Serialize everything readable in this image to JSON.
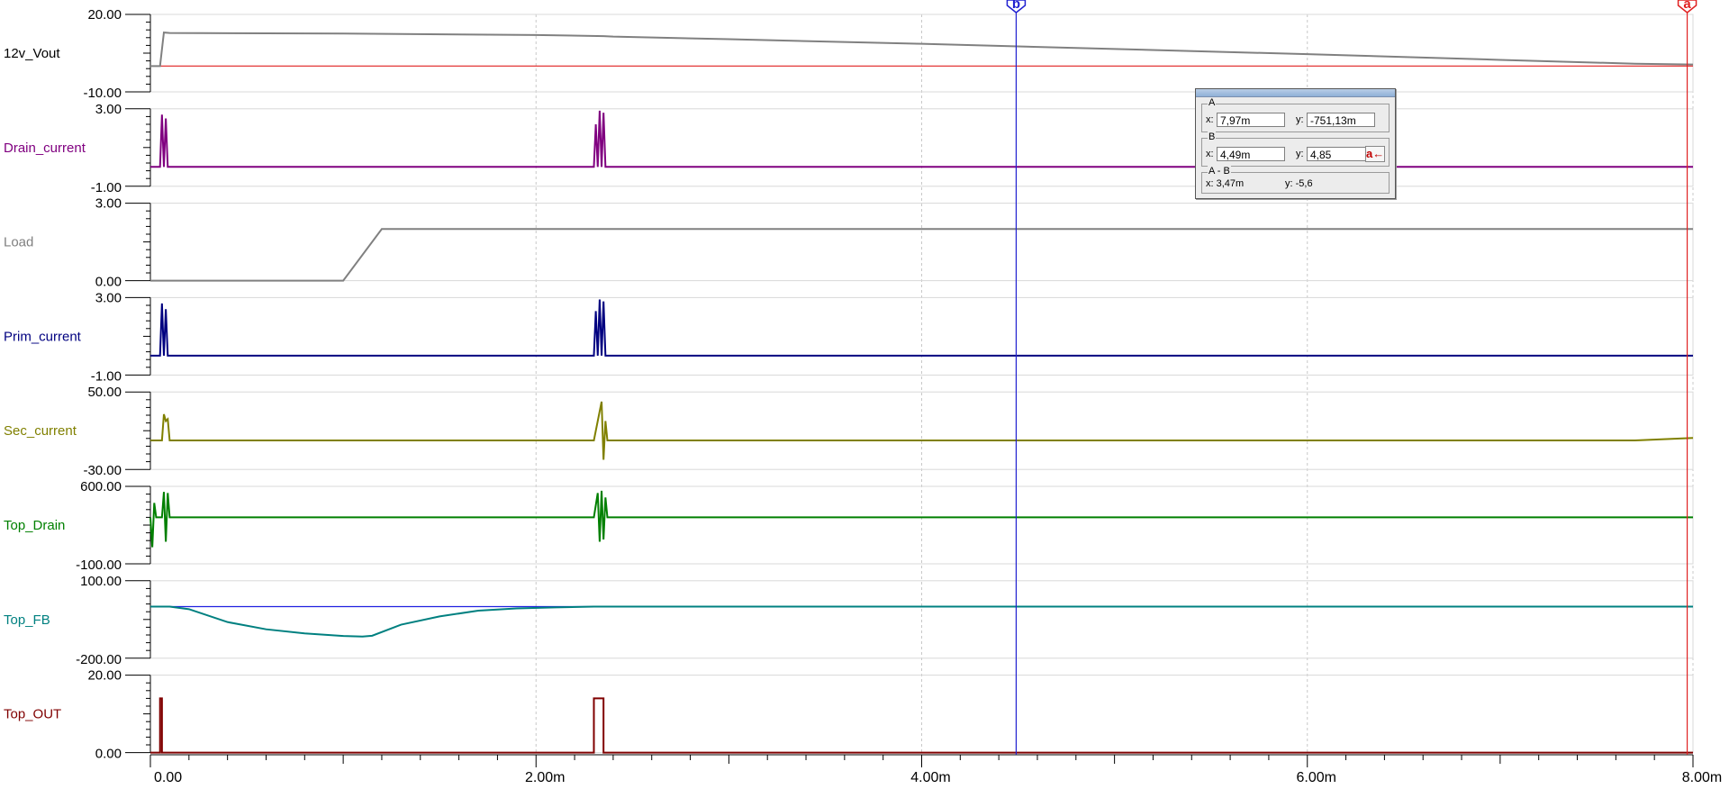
{
  "chart_data": {
    "type": "line",
    "x_axis": {
      "range": [
        0,
        0.008
      ],
      "tick_labels": [
        "0.00",
        "2.00m",
        "4.00m",
        "6.00m",
        "8.00m"
      ],
      "tick_values": [
        0,
        0.002,
        0.004,
        0.006,
        0.008
      ]
    },
    "grid": true,
    "panels": [
      {
        "name": "12v_Vout",
        "color": "#808080",
        "ymax_label": "20.00",
        "ymin_label": "-10.00",
        "ylim": [
          -10,
          20
        ],
        "points": [
          [
            0,
            0
          ],
          [
            5e-05,
            0
          ],
          [
            7e-05,
            13
          ],
          [
            0.0001,
            12.8
          ],
          [
            0.001,
            12.6
          ],
          [
            0.002,
            12
          ],
          [
            0.00235,
            11.6
          ],
          [
            0.0024,
            11.4
          ],
          [
            0.003,
            10.4
          ],
          [
            0.004,
            8.6
          ],
          [
            0.005,
            6.6
          ],
          [
            0.006,
            4.6
          ],
          [
            0.007,
            2.4
          ],
          [
            0.0077,
            0.9
          ],
          [
            0.008,
            0.6
          ]
        ],
        "ref_line": {
          "y": 0,
          "color": "#e02020"
        }
      },
      {
        "name": "Drain_current",
        "color": "#800080",
        "ymax_label": "3.00",
        "ymin_label": "-1.00",
        "ylim": [
          -1,
          3
        ],
        "points": [
          [
            0,
            0
          ],
          [
            5e-05,
            0
          ],
          [
            6e-05,
            2.7
          ],
          [
            7e-05,
            0
          ],
          [
            8e-05,
            2.5
          ],
          [
            9e-05,
            0
          ],
          [
            0.0023,
            0
          ],
          [
            0.00231,
            2.2
          ],
          [
            0.00232,
            0
          ],
          [
            0.00233,
            2.9
          ],
          [
            0.00234,
            0
          ],
          [
            0.00235,
            2.8
          ],
          [
            0.00236,
            0
          ],
          [
            0.008,
            0
          ]
        ]
      },
      {
        "name": "Load",
        "color": "#808080",
        "ymax_label": "3.00",
        "ymin_label": "0.00",
        "ylim": [
          0,
          3
        ],
        "points": [
          [
            0,
            0
          ],
          [
            0.001,
            0
          ],
          [
            0.0012,
            2
          ],
          [
            0.008,
            2
          ]
        ]
      },
      {
        "name": "Prim_current",
        "color": "#000080",
        "ymax_label": "3.00",
        "ymin_label": "-1.00",
        "ylim": [
          -1,
          3
        ],
        "points": [
          [
            0,
            0
          ],
          [
            5e-05,
            0
          ],
          [
            6e-05,
            2.7
          ],
          [
            7e-05,
            0
          ],
          [
            8e-05,
            2.4
          ],
          [
            9e-05,
            0
          ],
          [
            0.0023,
            0
          ],
          [
            0.00231,
            2.3
          ],
          [
            0.00232,
            0
          ],
          [
            0.00233,
            2.9
          ],
          [
            0.00234,
            0
          ],
          [
            0.00235,
            2.8
          ],
          [
            0.00236,
            0
          ],
          [
            0.008,
            0
          ]
        ]
      },
      {
        "name": "Sec_current",
        "color": "#808000",
        "ymax_label": "50.00",
        "ymin_label": "-30.00",
        "ylim": [
          -30,
          50
        ],
        "points": [
          [
            0,
            0
          ],
          [
            6e-05,
            0
          ],
          [
            7e-05,
            27
          ],
          [
            8e-05,
            20
          ],
          [
            9e-05,
            22
          ],
          [
            0.0001,
            0
          ],
          [
            0.0023,
            0
          ],
          [
            0.00234,
            40
          ],
          [
            0.00235,
            -20
          ],
          [
            0.00236,
            20
          ],
          [
            0.00237,
            0
          ],
          [
            0.0077,
            0
          ],
          [
            0.008,
            2.5
          ]
        ]
      },
      {
        "name": "Top_Drain",
        "color": "#008000",
        "ymax_label": "600.00",
        "ymin_label": "-100.00",
        "ylim": [
          -100,
          600
        ],
        "points": [
          [
            0,
            320
          ],
          [
            1e-05,
            50
          ],
          [
            2e-05,
            450
          ],
          [
            3e-05,
            320
          ],
          [
            6e-05,
            320
          ],
          [
            7e-05,
            550
          ],
          [
            8e-05,
            100
          ],
          [
            9e-05,
            540
          ],
          [
            0.0001,
            320
          ],
          [
            0.0023,
            320
          ],
          [
            0.00232,
            540
          ],
          [
            0.00233,
            100
          ],
          [
            0.00234,
            560
          ],
          [
            0.00235,
            120
          ],
          [
            0.00236,
            500
          ],
          [
            0.00237,
            320
          ],
          [
            0.008,
            320
          ]
        ]
      },
      {
        "name": "Top_FB",
        "color": "#008080",
        "ymax_label": "100.00",
        "ymin_label": "-200.00",
        "ylim": [
          -200,
          100
        ],
        "points": [
          [
            0,
            0
          ],
          [
            0.0001,
            0
          ],
          [
            0.0002,
            -10
          ],
          [
            0.0004,
            -60
          ],
          [
            0.0006,
            -88
          ],
          [
            0.0008,
            -104
          ],
          [
            0.001,
            -114
          ],
          [
            0.0011,
            -116
          ],
          [
            0.00115,
            -113
          ],
          [
            0.0013,
            -70
          ],
          [
            0.0015,
            -38
          ],
          [
            0.0017,
            -16
          ],
          [
            0.0019,
            -7
          ],
          [
            0.0021,
            -3
          ],
          [
            0.0023,
            0
          ],
          [
            0.008,
            0
          ]
        ],
        "ref_line": {
          "y": 0,
          "color": "#2020e0",
          "x_end": 0.00233
        }
      },
      {
        "name": "Top_OUT",
        "color": "#800000",
        "ymax_label": "20.00",
        "ymin_label": "0.00",
        "ylim": [
          0,
          20
        ],
        "points": [
          [
            0,
            0
          ],
          [
            5e-05,
            0
          ],
          [
            5e-05,
            14
          ],
          [
            6e-05,
            14
          ],
          [
            6e-05,
            0
          ],
          [
            0.0023,
            0
          ],
          [
            0.0023,
            14
          ],
          [
            0.00235,
            14
          ],
          [
            0.00235,
            0
          ],
          [
            0.008,
            0
          ]
        ]
      }
    ],
    "cursors": [
      {
        "label": "b",
        "x": 0.00449,
        "color": "#2020d0"
      },
      {
        "label": "a",
        "x": 0.00797,
        "color": "#e02020"
      }
    ]
  },
  "cursor_panel": {
    "a": {
      "group": "A",
      "x_label": "x:",
      "x": "7,97m",
      "y_label": "y:",
      "y": "-751,13m"
    },
    "b": {
      "group": "B",
      "x_label": "x:",
      "x": "4,49m",
      "y_label": "y:",
      "y": "4,85"
    },
    "diff": {
      "group": "A - B",
      "x": "x:  3,47m",
      "y": "y: -5,6"
    },
    "button": "a←"
  }
}
